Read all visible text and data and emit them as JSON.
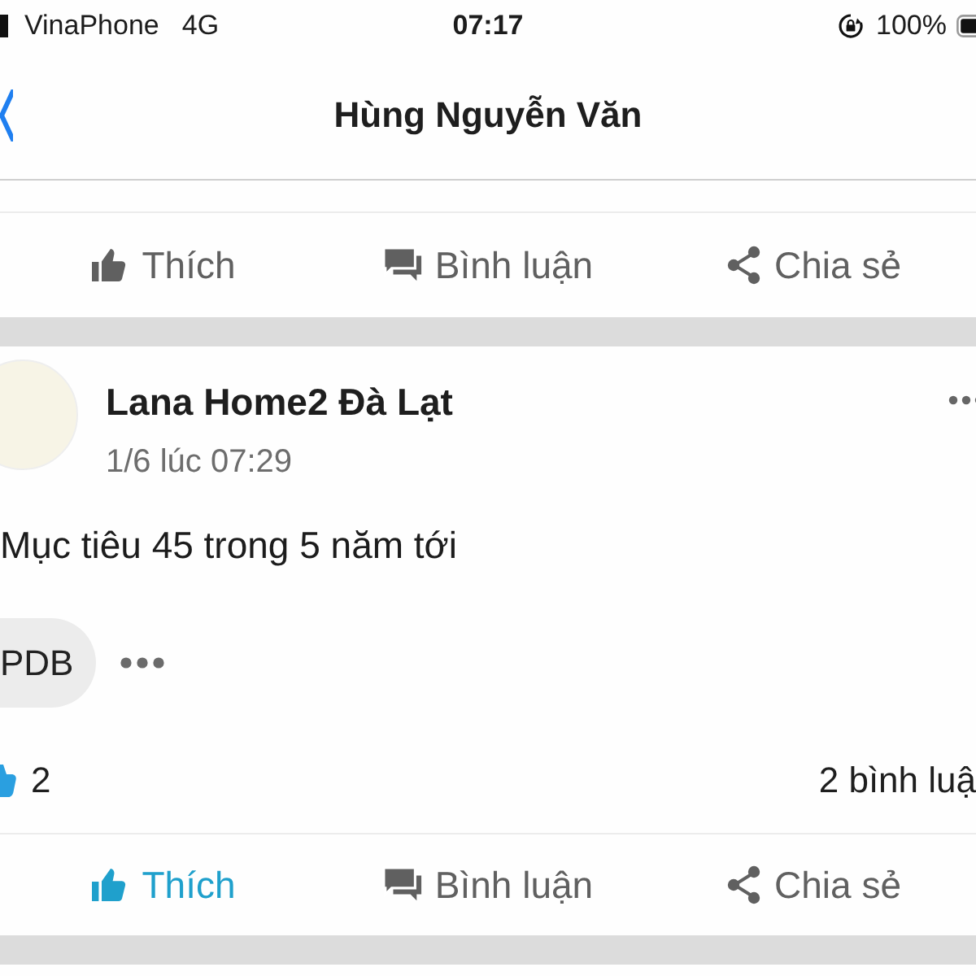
{
  "status_bar": {
    "carrier": "VinaPhone",
    "network": "4G",
    "time": "07:17",
    "battery": "100%"
  },
  "nav": {
    "title": "Hùng Nguyễn Văn"
  },
  "posts": [
    {
      "actions": [
        {
          "kind": "like",
          "label": "Thích",
          "active": false
        },
        {
          "kind": "comment",
          "label": "Bình luận",
          "active": false
        },
        {
          "kind": "share",
          "label": "Chia sẻ",
          "active": false
        }
      ]
    },
    {
      "author": "Lana Home2 Đà Lạt",
      "time": "1/6 lúc 07:29",
      "text": "Mục tiêu 45 trong 5 năm tới",
      "tags": [
        "PDB"
      ],
      "likes": "2",
      "comments": "2 bình luậ",
      "actions": [
        {
          "kind": "like",
          "label": "Thích",
          "active": true
        },
        {
          "kind": "comment",
          "label": "Bình luận",
          "active": false
        },
        {
          "kind": "share",
          "label": "Chia sẻ",
          "active": false
        }
      ]
    }
  ]
}
